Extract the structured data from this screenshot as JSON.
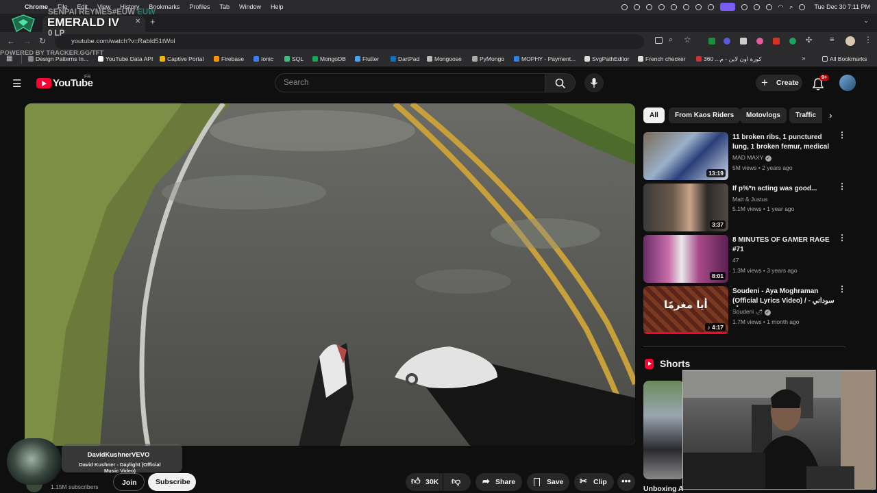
{
  "menubar": {
    "app": "Chrome",
    "items": [
      "File",
      "Edit",
      "View",
      "History",
      "Bookmarks",
      "Profiles",
      "Tab",
      "Window",
      "Help"
    ],
    "datetime": "Tue Dec 30  7:11 PM"
  },
  "overlay": {
    "summoner": "SENPAI REYMES#EUW",
    "region": "EUW",
    "rank": "EMERALD IV",
    "lp": "0 LP",
    "powered": "POWERED BY TRACKER.GG/TFT"
  },
  "browser": {
    "url": "youtube.com/watch?v=Rabld51tWol",
    "all_bookmarks": "All Bookmarks",
    "bookmarks": [
      {
        "label": "Design Patterns In...",
        "color": "#888"
      },
      {
        "label": "YouTube Data API",
        "color": "#ffffff"
      },
      {
        "label": "Captive Portal",
        "color": "#f4b400"
      },
      {
        "label": "Firebase",
        "color": "#ff9100"
      },
      {
        "label": "Ionic",
        "color": "#3880ff"
      },
      {
        "label": "SQL",
        "color": "#3fbf7f"
      },
      {
        "label": "MongoDB",
        "color": "#13aa52"
      },
      {
        "label": "Flutter",
        "color": "#42a5f5"
      },
      {
        "label": "DartPad",
        "color": "#0175c2"
      },
      {
        "label": "Mongoose",
        "color": "#bbbbbb"
      },
      {
        "label": "PyMongo",
        "color": "#aaaaaa"
      },
      {
        "label": "MOPHY - Payment...",
        "color": "#2f80ed"
      },
      {
        "label": "SvgPathEditor",
        "color": "#dddddd"
      },
      {
        "label": "French checker",
        "color": "#dddddd"
      },
      {
        "label": "كورة اون لاين - م...  360",
        "color": "#cc3333"
      }
    ]
  },
  "youtube": {
    "logo_text": "YouTube",
    "region": "FR",
    "search_placeholder": "Search",
    "create": "Create",
    "notif_badge": "9+",
    "chips": [
      "All",
      "From Kaos Riders",
      "Motovlogs",
      "Traffic"
    ],
    "recommendations": [
      {
        "title": "11 broken ribs, 1 punctured lung, 1 broken femur, medical ...",
        "channel": "MAD MAXY",
        "verified": true,
        "meta": "5M views • 2 years ago",
        "duration": "13:19"
      },
      {
        "title": "If p%*n acting was good...",
        "channel": "Matt & Justus",
        "verified": false,
        "meta": "5.1M views • 1 year ago",
        "duration": "3:37"
      },
      {
        "title": "8 MINUTES OF GAMER RAGE #71",
        "channel": "47",
        "verified": false,
        "meta": "1.3M views • 3 years ago",
        "duration": "8:01"
      },
      {
        "title": "Soudeni - Aya Moghraman (Official Lyrics Video) / سوداني - أيا ...",
        "channel": "Soudeni 🌶",
        "verified": true,
        "meta": "1.7M views • 1 month ago",
        "duration": "♪ 4:17",
        "thumb_text": "أيا مغرمًا"
      }
    ],
    "shorts_title": "Shorts",
    "shorts_caption": "Unboxing A",
    "subscribers": "1.15M subscribers",
    "join": "Join",
    "subscribe": "Subscribe",
    "likes": "30K",
    "share": "Share",
    "save": "Save",
    "clip": "Clip"
  },
  "now_playing": {
    "artist": "DavidKushnerVEVO",
    "track": "David Kushner - Daylight (Official Music Video)"
  },
  "colors": {
    "youtube_red": "#ff0033",
    "accent": "#3ea6ff"
  }
}
